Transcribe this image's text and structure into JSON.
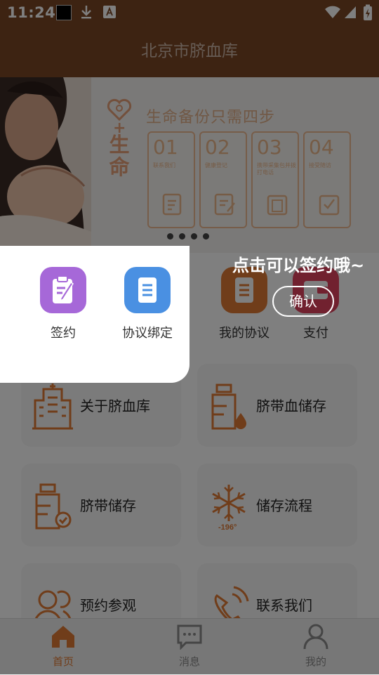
{
  "status_bar": {
    "time": "11:24"
  },
  "app_bar": {
    "title": "北京市脐血库"
  },
  "banner": {
    "heading": "生命备份只需四步",
    "side_text": "生命",
    "steps": [
      {
        "num": "01",
        "label": "联系我们"
      },
      {
        "num": "02",
        "label": "健康登记"
      },
      {
        "num": "03",
        "label": "携带采集包并拨打电话"
      },
      {
        "num": "04",
        "label": "接受随访"
      }
    ]
  },
  "menu": [
    {
      "label": "签约",
      "icon": "contract-icon",
      "color": "#a668d8"
    },
    {
      "label": "协议绑定",
      "icon": "document-icon",
      "color": "#4a90e2"
    },
    {
      "label": "我的协议",
      "icon": "document-icon",
      "color": "#e07a34"
    },
    {
      "label": "支付",
      "icon": "wallet-icon",
      "color": "#e2435e"
    }
  ],
  "cards": [
    {
      "label": "关于脐血库",
      "icon": "building-icon"
    },
    {
      "label": "脐带血储存",
      "icon": "storage-jar-icon"
    },
    {
      "label": "脐带储存",
      "icon": "storage-check-icon"
    },
    {
      "label": "储存流程",
      "icon": "snowflake-icon"
    },
    {
      "label": "预约参观",
      "icon": "people-icon"
    },
    {
      "label": "联系我们",
      "icon": "phone-icon"
    }
  ],
  "guide": {
    "tip": "点击可以签约哦~",
    "confirm": "确认"
  },
  "tabs": [
    {
      "label": "首页",
      "icon": "home-icon"
    },
    {
      "label": "消息",
      "icon": "message-icon"
    },
    {
      "label": "我的",
      "icon": "user-icon"
    }
  ],
  "colors": {
    "primary": "#7a4724",
    "accent": "#e07a34"
  }
}
